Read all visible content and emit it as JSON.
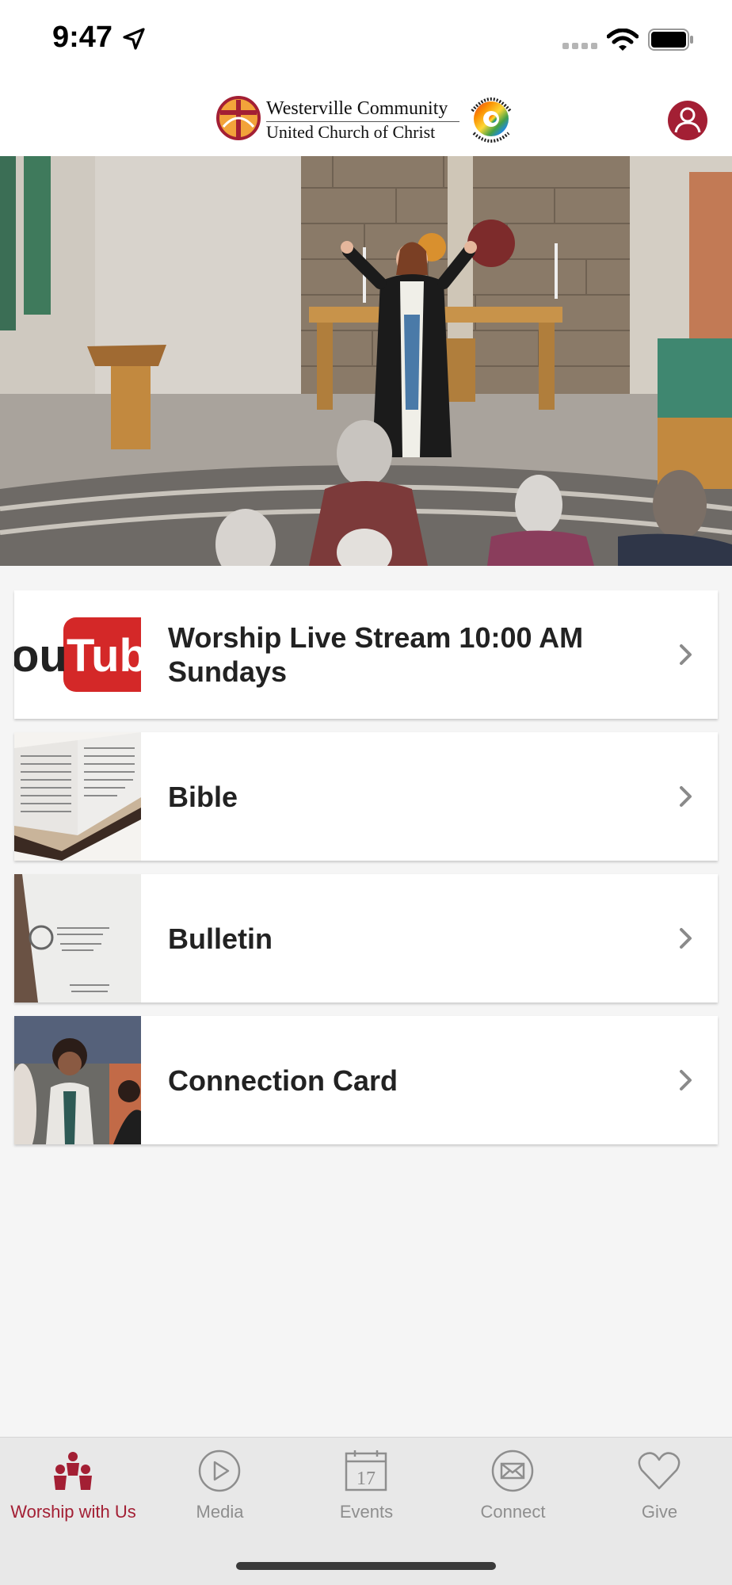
{
  "status_bar": {
    "time": "9:47"
  },
  "header": {
    "logo_line1": "Westerville Community",
    "logo_line2": "United Church of Christ",
    "badge_text": "OPEN & AFFIRMING CONGREGATION"
  },
  "list": {
    "items": [
      {
        "label": "Worship Live Stream 10:00 AM Sundays",
        "thumb": "youtube"
      },
      {
        "label": "Bible",
        "thumb": "bible"
      },
      {
        "label": "Bulletin",
        "thumb": "bulletin"
      },
      {
        "label": "Connection Card",
        "thumb": "connection"
      }
    ]
  },
  "tab_bar": {
    "active_color": "#a31f34",
    "inactive_color": "#8e8e8e",
    "tabs": [
      {
        "label": "Worship with Us",
        "icon": "people-icon"
      },
      {
        "label": "Media",
        "icon": "play-icon"
      },
      {
        "label": "Events",
        "icon": "calendar-icon",
        "icon_text": "17"
      },
      {
        "label": "Connect",
        "icon": "mail-icon"
      },
      {
        "label": "Give",
        "icon": "heart-icon"
      }
    ]
  }
}
